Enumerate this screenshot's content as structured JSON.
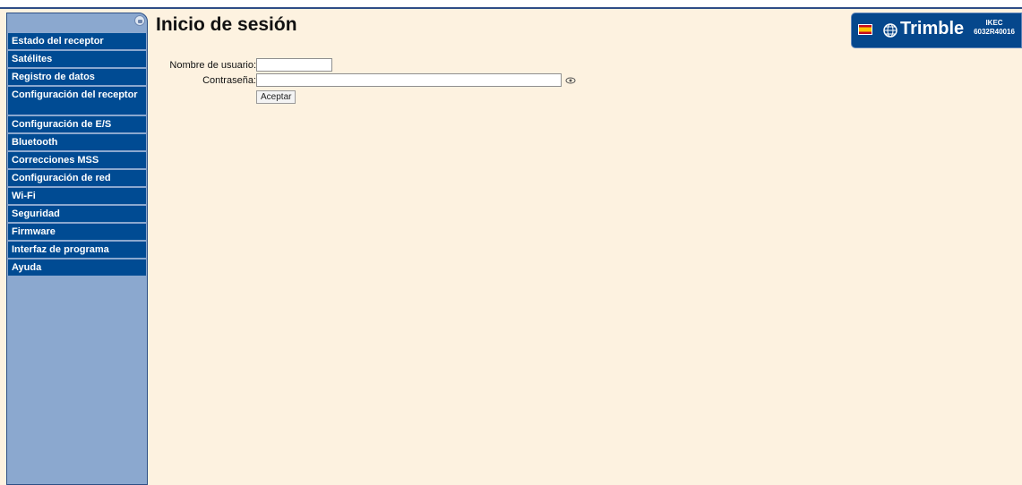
{
  "header": {
    "page_title": "Inicio de sesión"
  },
  "sidebar": {
    "items": [
      {
        "label": "Estado del receptor"
      },
      {
        "label": "Satélites"
      },
      {
        "label": "Registro de datos"
      },
      {
        "label": "Configuración del receptor"
      },
      {
        "label": "Configuración de E/S"
      },
      {
        "label": "Bluetooth"
      },
      {
        "label": "Correcciones MSS"
      },
      {
        "label": "Configuración de red"
      },
      {
        "label": "Wi-Fi"
      },
      {
        "label": "Seguridad"
      },
      {
        "label": "Firmware"
      },
      {
        "label": "Interfaz de programa"
      },
      {
        "label": "Ayuda"
      }
    ]
  },
  "form": {
    "username_label": "Nombre de usuario:",
    "username_value": "",
    "password_label": "Contraseña:",
    "password_value": "",
    "submit_label": "Aceptar"
  },
  "branding": {
    "brand": "Trimble",
    "device_name": "IKEC",
    "serial": "6032R40016"
  },
  "colors": {
    "background": "#fdf2e0",
    "sidebar": "#8ba8cf",
    "nav_item": "#004b93",
    "logo": "#05478c"
  },
  "icons": {
    "language_flag": "spanish-flag-icon",
    "show_password": "eye-icon",
    "sidebar_lock": "lock-icon"
  }
}
